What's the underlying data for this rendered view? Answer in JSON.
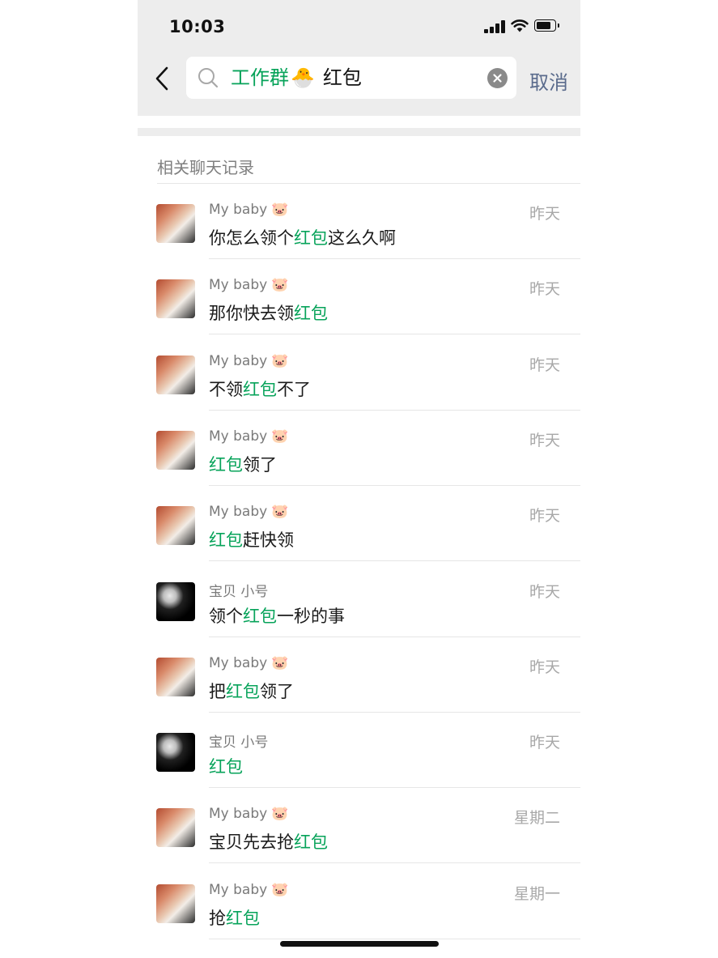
{
  "status_bar": {
    "time": "10:03"
  },
  "search": {
    "back_icon": "chevron-left-icon",
    "search_icon": "magnifier-icon",
    "query_green": "工作群",
    "query_emoji": "🐣",
    "query_plain": "红包",
    "clear_icon": "clear-circle-icon",
    "cancel_label": "取消"
  },
  "section": {
    "title": "相关聊天记录"
  },
  "results": [
    {
      "avatar": "warm",
      "name": "My baby",
      "emoji": "🐷",
      "time": "昨天",
      "pre": "你怎么领个",
      "hl": "红包",
      "post": "这么久啊"
    },
    {
      "avatar": "warm",
      "name": "My baby",
      "emoji": "🐷",
      "time": "昨天",
      "pre": "那你快去领",
      "hl": "红包",
      "post": ""
    },
    {
      "avatar": "warm",
      "name": "My baby",
      "emoji": "🐷",
      "time": "昨天",
      "pre": "不领",
      "hl": "红包",
      "post": "不了"
    },
    {
      "avatar": "warm",
      "name": "My baby",
      "emoji": "🐷",
      "time": "昨天",
      "pre": "",
      "hl": "红包",
      "post": "领了"
    },
    {
      "avatar": "warm",
      "name": "My baby",
      "emoji": "🐷",
      "time": "昨天",
      "pre": "",
      "hl": "红包",
      "post": "赶快领"
    },
    {
      "avatar": "dark",
      "name": "宝贝 小号",
      "emoji": "",
      "time": "昨天",
      "pre": "领个",
      "hl": "红包",
      "post": "一秒的事"
    },
    {
      "avatar": "warm",
      "name": "My baby",
      "emoji": "🐷",
      "time": "昨天",
      "pre": "把",
      "hl": "红包",
      "post": "领了"
    },
    {
      "avatar": "dark",
      "name": "宝贝 小号",
      "emoji": "",
      "time": "昨天",
      "pre": "",
      "hl": "红包",
      "post": ""
    },
    {
      "avatar": "warm",
      "name": "My baby",
      "emoji": "🐷",
      "time": "星期二",
      "pre": "宝贝先去抢",
      "hl": "红包",
      "post": ""
    },
    {
      "avatar": "warm",
      "name": "My baby",
      "emoji": "🐷",
      "time": "星期一",
      "pre": "抢",
      "hl": "红包",
      "post": ""
    }
  ],
  "colors": {
    "highlight": "#07a35a",
    "cancel": "#5a6b8c",
    "header_bg": "#ededed"
  }
}
